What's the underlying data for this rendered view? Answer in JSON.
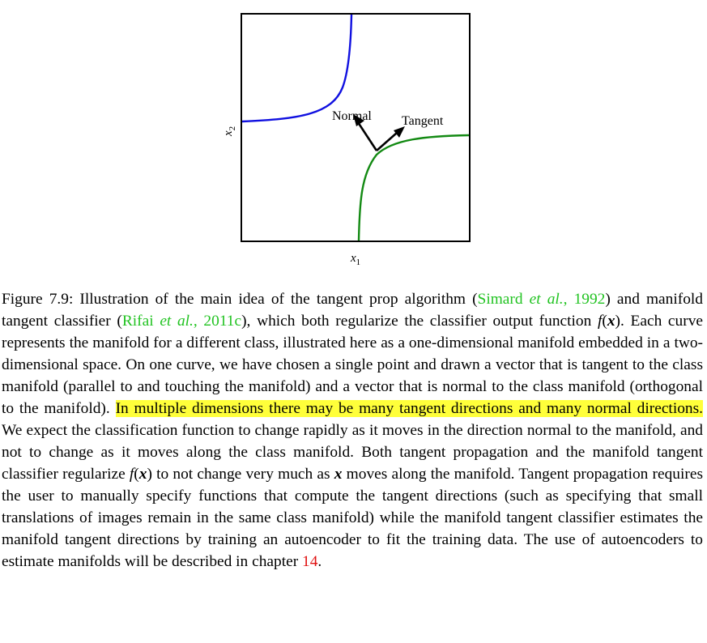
{
  "figure": {
    "x_axis_label": "x",
    "x_axis_sub": "1",
    "y_axis_label": "x",
    "y_axis_sub": "2",
    "normal_label": "Normal",
    "tangent_label": "Tangent",
    "colors": {
      "blue_curve": "#1010e0",
      "green_curve": "#138a13",
      "arrow": "#000000",
      "frame": "#000000"
    }
  },
  "caption": {
    "fig_label": "Figure 7.9:",
    "p1": " Illustration of the main idea of the tangent prop algorithm (",
    "cite1_author": "Simard ",
    "cite1_etal": "et al.",
    "cite1_sep": ", ",
    "cite1_year": "1992",
    "p2": ") and manifold tangent classifier (",
    "cite2_author": "Rifai ",
    "cite2_etal": "et al.",
    "cite2_sep": ", ",
    "cite2_year": "2011c",
    "p3": "), which both regularize the classifier output function ",
    "f1_f": "f",
    "f1_open": "(",
    "f1_x": "x",
    "f1_close": ")",
    "p4": ". Each curve represents the manifold for a different class, illustrated here as a one-dimensional manifold embedded in a two-dimensional space. On one curve, we have chosen a single point and drawn a vector that is tangent to the class manifold (parallel to and touching the manifold) and a vector that is normal to the class manifold (orthogonal to the manifold). ",
    "highlight": "In multiple dimensions there may be many tangent directions and many normal directions.",
    "p5": " We expect the classification function to change rapidly as it moves in the direction normal to the manifold, and not to change as it moves along the class manifold. Both tangent propagation and the manifold tangent classifier regularize ",
    "f2_f": "f",
    "f2_open": "(",
    "f2_x": "x",
    "f2_close": ")",
    "p6": " to not change very much as ",
    "x3": "x",
    "p7": " moves along the manifold. Tangent propagation requires the user to manually specify functions that compute the tangent directions (such as specifying that small translations of images remain in the same class manifold) while the manifold tangent classifier estimates the manifold tangent directions by training an autoencoder to fit the training data. The use of autoencoders to estimate manifolds will be described in chapter ",
    "chapter_ref": "14",
    "p8": "."
  }
}
